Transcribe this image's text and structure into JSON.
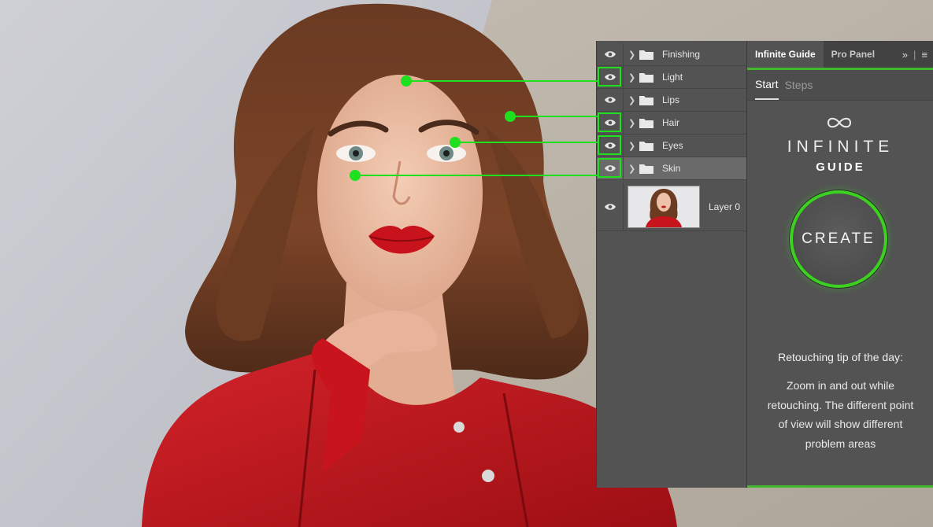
{
  "layers": [
    {
      "name": "Finishing",
      "highlighted": false,
      "selected": false
    },
    {
      "name": "Light",
      "highlighted": true,
      "selected": false
    },
    {
      "name": "Lips",
      "highlighted": false,
      "selected": false
    },
    {
      "name": "Hair",
      "highlighted": true,
      "selected": false
    },
    {
      "name": "Eyes",
      "highlighted": true,
      "selected": false
    },
    {
      "name": "Skin",
      "highlighted": true,
      "selected": true
    }
  ],
  "base_layer": {
    "name": "Layer 0"
  },
  "panel_tabs": {
    "active": "Infinite Guide",
    "inactive": "Pro Panel",
    "expand_icon": "double-chevron-right-icon",
    "menu_icon": "hamburger-menu-icon"
  },
  "sub_tabs": {
    "active": "Start",
    "inactive": "Steps"
  },
  "brand": {
    "line1": "INFINITE",
    "line2": "GUIDE",
    "logo_icon": "infinity-icon"
  },
  "create_button": {
    "label": "CREATE"
  },
  "tip": {
    "title": "Retouching tip of the day:",
    "body": "Zoom in and out while retouching. The different point of view will show different problem areas"
  },
  "colors": {
    "accent_green": "#1fe01f",
    "panel_bg": "#535353",
    "tab_bg": "#424242",
    "jacket_red": "#c8141c"
  }
}
